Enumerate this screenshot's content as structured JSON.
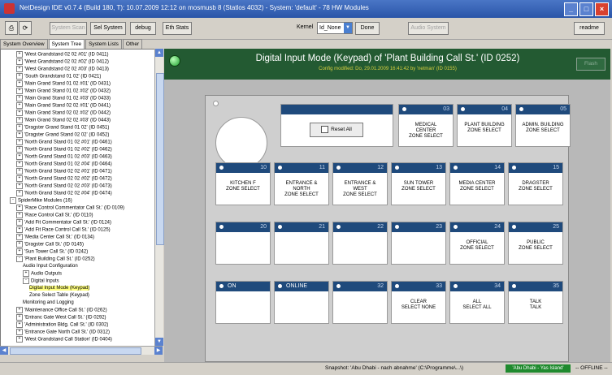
{
  "window": {
    "title": "NetDesign IDE v0.7.4 (Build 180, T): 10.07.2009 12:12 on mosmusb 8 (Statlos 4032) - System: 'default' - 78 HW Modules"
  },
  "toolbar": {
    "system_scan": "System Scan",
    "set_system": "Sel System",
    "debug": "debug",
    "eth_stats": "Eth Stats",
    "kernel_label": "Kernel",
    "kernel_value": "Id_None",
    "done": "Done",
    "audio_system": "Audio System",
    "readme": "readme"
  },
  "tabs": [
    "System Overview",
    "System Tree",
    "System Lists",
    "Other"
  ],
  "tree": [
    {
      "t": "'West Grandstand 02 02 #01' (ID 0411)",
      "d": 2,
      "e": "+"
    },
    {
      "t": "'West Grandstand 02 02 #02' (ID 0412)",
      "d": 2,
      "e": "+"
    },
    {
      "t": "'West Grandstand 02 02 #03' (ID 0413)",
      "d": 2,
      "e": "+"
    },
    {
      "t": "'South Grandstand 01 02' (ID 0421)",
      "d": 2,
      "e": "+"
    },
    {
      "t": "'Main Grand Stand 01 02 #01' (ID 0431)",
      "d": 2,
      "e": "+"
    },
    {
      "t": "'Main Grand Stand 01 02 #02' (ID 0432)",
      "d": 2,
      "e": "+"
    },
    {
      "t": "'Main Grand Stand 01 02 #03' (ID 0433)",
      "d": 2,
      "e": "+"
    },
    {
      "t": "'Main Grand Stand 02 02 #01' (ID 0441)",
      "d": 2,
      "e": "+"
    },
    {
      "t": "'Main Grand Stand 02 02 #02' (ID 0442)",
      "d": 2,
      "e": "+"
    },
    {
      "t": "'Main Grand Stand 02 02 #03' (ID 0443)",
      "d": 2,
      "e": "+"
    },
    {
      "t": "'Dragster Grand Stand 01 02' (ID 0451)",
      "d": 2,
      "e": "+"
    },
    {
      "t": "'Dragster Grand Stand 02 02' (ID 0452)",
      "d": 2,
      "e": "+"
    },
    {
      "t": "'North Grand Stand 01 02 #01' (ID 0461)",
      "d": 2,
      "e": "+"
    },
    {
      "t": "'North Grand Stand 01 02 #02' (ID 0462)",
      "d": 2,
      "e": "+"
    },
    {
      "t": "'North Grand Stand 01 02 #03' (ID 0463)",
      "d": 2,
      "e": "+"
    },
    {
      "t": "'North Grand Stand 01 02 #04' (ID 0464)",
      "d": 2,
      "e": "+"
    },
    {
      "t": "'North Grand Stand 02 02 #01' (ID 0471)",
      "d": 2,
      "e": "+"
    },
    {
      "t": "'North Grand Stand 02 02 #02' (ID 0472)",
      "d": 2,
      "e": "+"
    },
    {
      "t": "'North Grand Stand 02 02 #03' (ID 0473)",
      "d": 2,
      "e": "+"
    },
    {
      "t": "'North Grand Stand 02 02 #04' (ID 0474)",
      "d": 2,
      "e": "+"
    },
    {
      "t": "SpiderMike Modules (16)",
      "d": 1,
      "e": "-"
    },
    {
      "t": "'Race Control Commentator Call St.' (ID 0109)",
      "d": 2,
      "e": "+"
    },
    {
      "t": "'Race Control Call St.' (ID 0110)",
      "d": 2,
      "e": "+"
    },
    {
      "t": "'Add Fit Commentator Call St.' (ID 0124)",
      "d": 2,
      "e": "+"
    },
    {
      "t": "'Add Fit Race Control Call St.' (ID 0125)",
      "d": 2,
      "e": "+"
    },
    {
      "t": "'Media Center Call St.' (ID 0134)",
      "d": 2,
      "e": "+"
    },
    {
      "t": "'Dragster Call St.' (ID 0145)",
      "d": 2,
      "e": "+"
    },
    {
      "t": "'Sun Tower Call St.' (ID 0242)",
      "d": 2,
      "e": "+"
    },
    {
      "t": "'Plant Building Call St.' (ID 0252)",
      "d": 2,
      "e": "-"
    },
    {
      "t": "Audio Input Configuration",
      "d": 3,
      "e": ""
    },
    {
      "t": "Audio Outputs",
      "d": 3,
      "e": "+"
    },
    {
      "t": "Digital Inputs",
      "d": 3,
      "e": "-"
    },
    {
      "t": "Digital Input Mode (Keypad)",
      "d": 4,
      "e": "",
      "sel": true
    },
    {
      "t": "Zone Select Table (Keypad)",
      "d": 4,
      "e": ""
    },
    {
      "t": "Monitoring and Logging",
      "d": 3,
      "e": ""
    },
    {
      "t": "'Maintenance Office Call St.' (ID 0262)",
      "d": 2,
      "e": "+"
    },
    {
      "t": "'Entranc Gate West Call St.' (ID 0292)",
      "d": 2,
      "e": "+"
    },
    {
      "t": "'Administration Bldg. Call St.' (ID 0302)",
      "d": 2,
      "e": "+"
    },
    {
      "t": "'Entrance Gate North Call St.' (ID 0312)",
      "d": 2,
      "e": "+"
    },
    {
      "t": "'West Grandstand Call Station' (ID 0404)",
      "d": 2,
      "e": "+"
    }
  ],
  "main": {
    "title": "Digital Input Mode (Keypad) of 'Plant Building Call St.' (ID 0252)",
    "subtitle": "Config modified: Do, 29.01.2009 16:41:42 by 'netman' (ID 0155)",
    "flash_label": "Flash",
    "reset_all": "Reset All",
    "keys": [
      {
        "num": "03",
        "text": "MEDICAL\nCENTER\nZONE SELECT"
      },
      {
        "num": "04",
        "text": "PLANT BUILDING\nZONE SELECT"
      },
      {
        "num": "05",
        "text": "ADMIN. BUILDING\nZONE SELECT"
      },
      {
        "num": "10",
        "text": "KITCHEN F\nZONE SELECT"
      },
      {
        "num": "11",
        "text": "ENTRANCE &\nNORTH\nZONE SELECT"
      },
      {
        "num": "12",
        "text": "ENTRANCE &\nWEST\nZONE SELECT"
      },
      {
        "num": "13",
        "text": "SUN TOWER\nZONE SELECT"
      },
      {
        "num": "14",
        "text": "MEDIA CENTER\nZONE SELECT"
      },
      {
        "num": "15",
        "text": "DRAGSTER\nZONE SELECT"
      },
      {
        "num": "20",
        "text": ""
      },
      {
        "num": "21",
        "text": ""
      },
      {
        "num": "22",
        "text": ""
      },
      {
        "num": "23",
        "text": ""
      },
      {
        "num": "24",
        "text": "OFFICIAL\nZONE SELECT"
      },
      {
        "num": "25",
        "text": "PUBLIC\nZONE SELECT"
      },
      {
        "num": "ON",
        "text": "",
        "label": true
      },
      {
        "num": "ONLINE",
        "text": "",
        "label": true
      },
      {
        "num": "32",
        "text": ""
      },
      {
        "num": "33",
        "text": "CLEAR\nSELECT NONE"
      },
      {
        "num": "34",
        "text": "ALL\nSELECT ALL"
      },
      {
        "num": "35",
        "text": "TALK\nTALK"
      }
    ]
  },
  "status": {
    "snapshot": "Snapshot: 'Abu Dhabi - nach abnahme' (C:\\Programme\\...\\)",
    "badge": "'Abu Dhabi - Yas Island'",
    "offline": "-- OFFLINE --"
  }
}
